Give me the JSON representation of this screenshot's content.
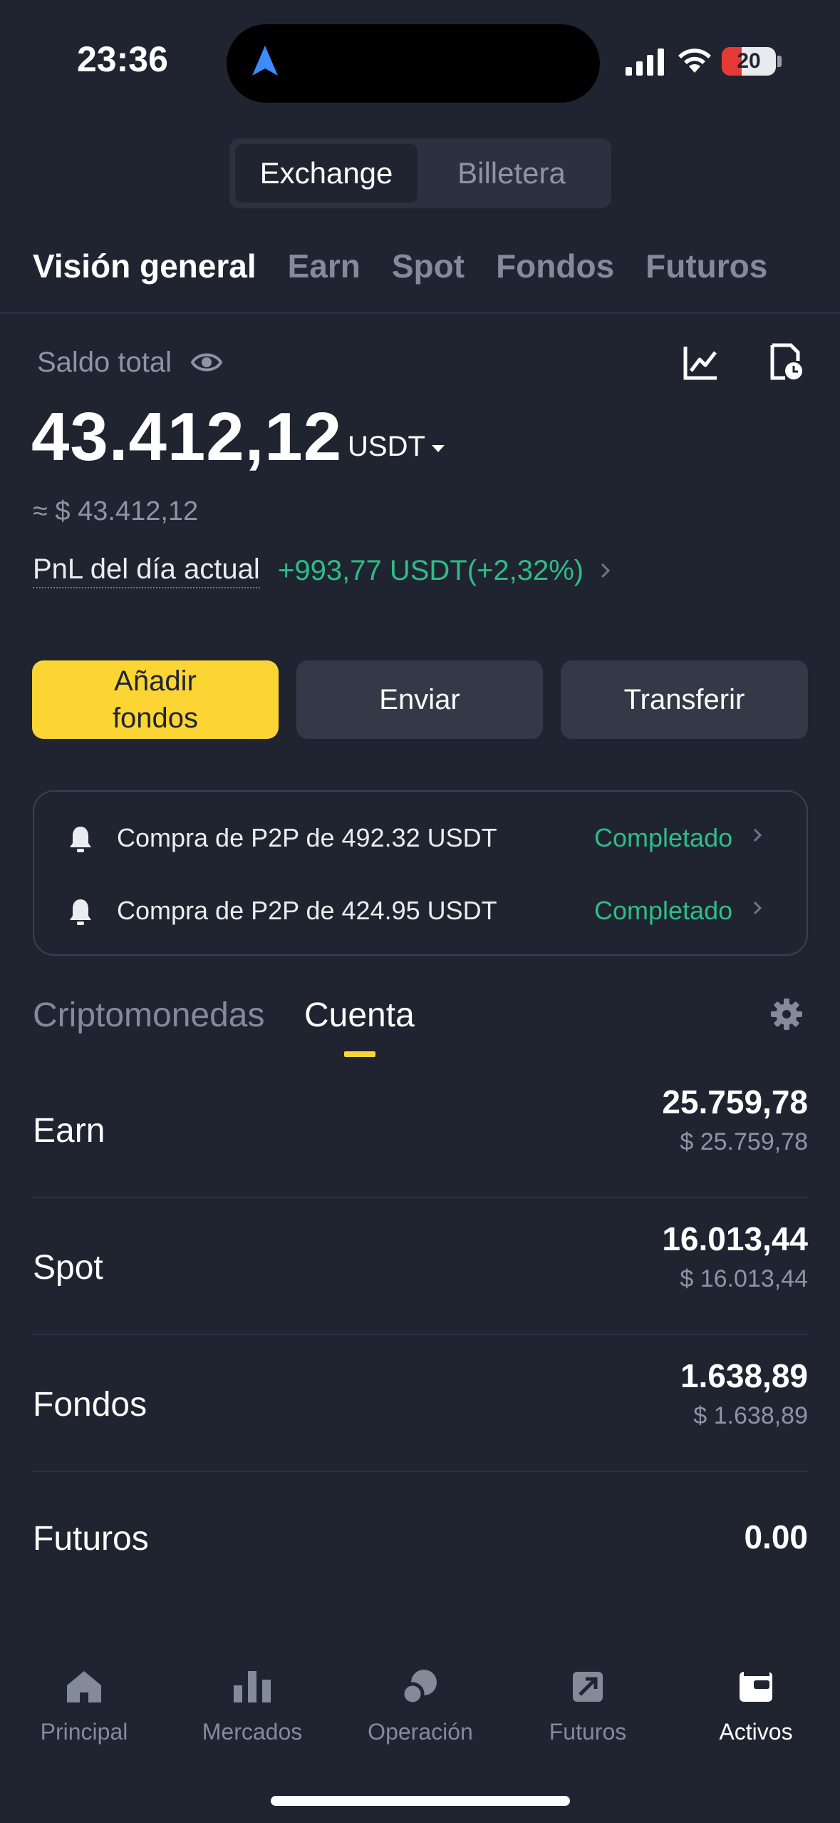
{
  "status_bar": {
    "time": "23:36",
    "battery": "20"
  },
  "segmented": {
    "active": "Exchange",
    "inactive": "Billetera"
  },
  "tabs": [
    "Visión general",
    "Earn",
    "Spot",
    "Fondos",
    "Futuros"
  ],
  "balance": {
    "label": "Saldo total",
    "amount": "43.412,12",
    "currency": "USDT",
    "approx": "≈ $ 43.412,12",
    "pnl_label": "PnL del día actual",
    "pnl_value": "+993,77 USDT(+2,32%)"
  },
  "actions": {
    "add_funds": "Añadir\nfondos",
    "send": "Enviar",
    "transfer": "Transferir"
  },
  "notifications": [
    {
      "text": "Compra de P2P de 492.32 USDT",
      "status": "Completado"
    },
    {
      "text": "Compra de P2P de 424.95 USDT",
      "status": "Completado"
    }
  ],
  "section_tabs": {
    "crypto": "Criptomonedas",
    "account": "Cuenta"
  },
  "accounts": [
    {
      "name": "Earn",
      "value": "25.759,78",
      "usd": "$ 25.759,78"
    },
    {
      "name": "Spot",
      "value": "16.013,44",
      "usd": "$ 16.013,44"
    },
    {
      "name": "Fondos",
      "value": "1.638,89",
      "usd": "$ 1.638,89"
    },
    {
      "name": "Futuros",
      "value": "0.00",
      "usd": ""
    }
  ],
  "bottom_nav": [
    "Principal",
    "Mercados",
    "Operación",
    "Futuros",
    "Activos"
  ],
  "colors": {
    "background": "#1f2430",
    "accent": "#fcd535",
    "positive": "#2ebd85",
    "muted": "#848b98"
  }
}
